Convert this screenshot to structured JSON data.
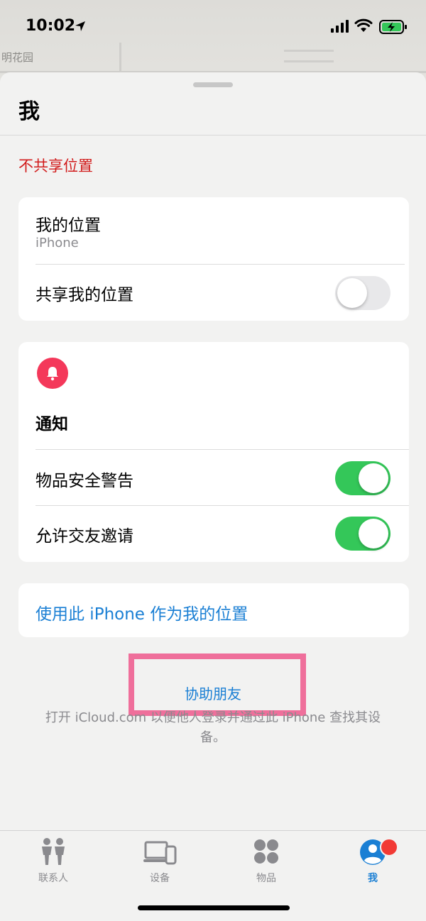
{
  "status_bar": {
    "time": "10:02"
  },
  "map": {
    "place_label": "明花园"
  },
  "sheet": {
    "title": "我",
    "stop_sharing": "不共享位置"
  },
  "my_location_card": {
    "title": "我的位置",
    "device": "iPhone",
    "share_label": "共享我的位置",
    "share_on": false
  },
  "notifications_card": {
    "title": "通知",
    "icon": "bell-icon",
    "items": [
      {
        "label": "物品安全警告",
        "on": true
      },
      {
        "label": "允许交友邀请",
        "on": true
      }
    ]
  },
  "use_iphone_link": "使用此 iPhone 作为我的位置",
  "help_friend": {
    "link": "协助朋友",
    "description": "打开 iCloud.com 以便他人登录并通过此 iPhone 查找其设备。"
  },
  "tabs": [
    {
      "label": "联系人",
      "icon": "people-icon",
      "active": false
    },
    {
      "label": "设备",
      "icon": "devices-icon",
      "active": false
    },
    {
      "label": "物品",
      "icon": "items-icon",
      "active": false
    },
    {
      "label": "我",
      "icon": "me-icon",
      "active": true
    }
  ],
  "colors": {
    "accent": "#1a7fd4",
    "destructive": "#d11a1a",
    "toggle_on": "#34c759",
    "bell": "#f4385a",
    "highlight": "#ef6f9b"
  }
}
